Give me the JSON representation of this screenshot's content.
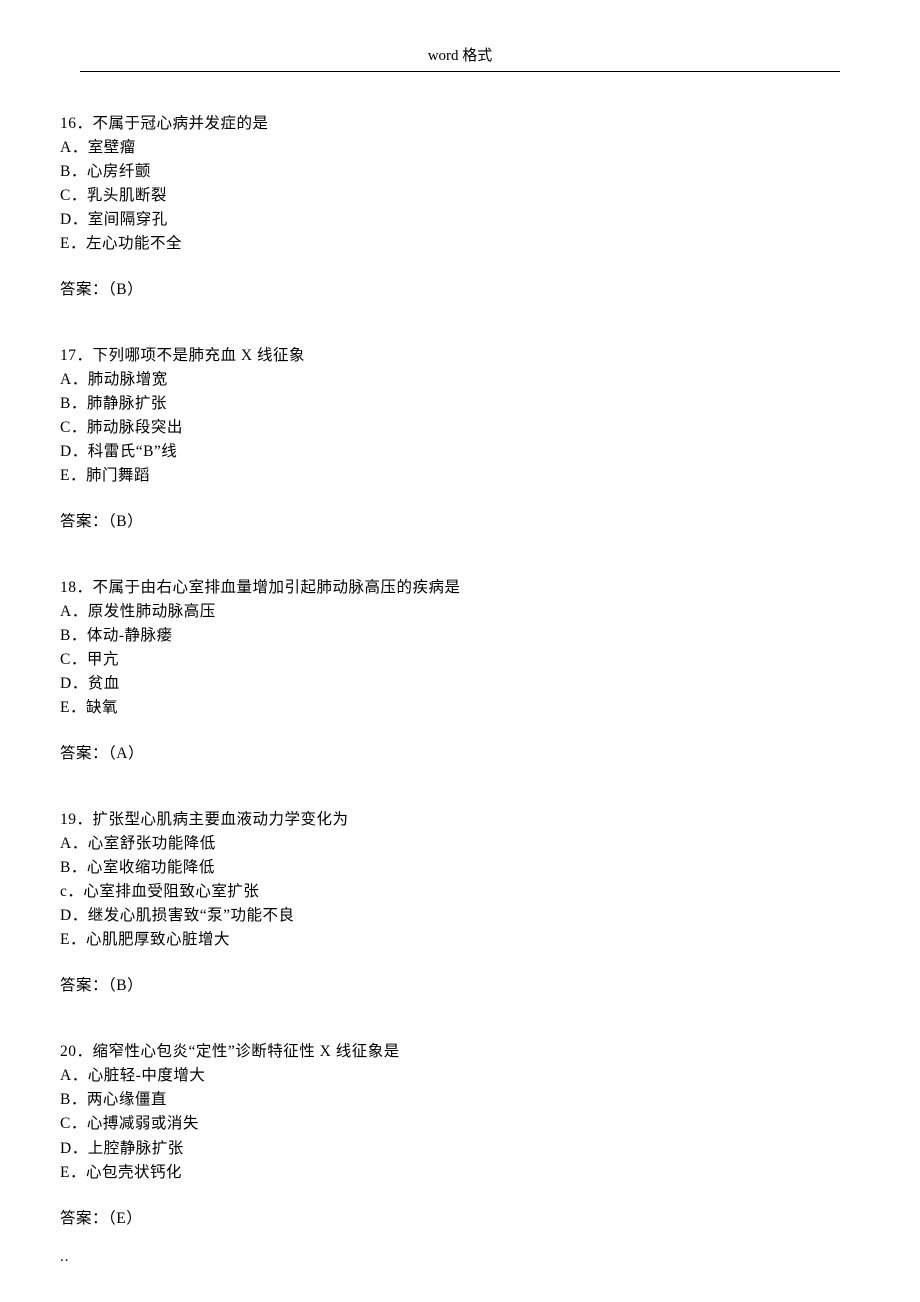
{
  "header": "word 格式",
  "footer": "..",
  "questions": [
    {
      "number": "16．",
      "stem": "不属于冠心病并发症的是",
      "options": [
        "A．室壁瘤",
        "B．心房纤颤",
        "C．乳头肌断裂",
        "D．室间隔穿孔",
        "E．左心功能不全"
      ],
      "answer_label": "答案：（B）"
    },
    {
      "number": "17．",
      "stem": "下列哪项不是肺充血 X 线征象",
      "options": [
        "A．肺动脉增宽",
        "B．肺静脉扩张",
        "C．肺动脉段突出",
        "D．科雷氏“B”线",
        "E．肺门舞蹈"
      ],
      "answer_label": "答案：（B）"
    },
    {
      "number": "18．",
      "stem": "不属于由右心室排血量增加引起肺动脉高压的疾病是",
      "options": [
        "A．原发性肺动脉高压",
        "B．体动-静脉瘘",
        "C．甲亢",
        "D．贫血",
        "E．缺氧"
      ],
      "answer_label": "答案：（A）"
    },
    {
      "number": "19．",
      "stem": "扩张型心肌病主要血液动力学变化为",
      "options": [
        "A．心室舒张功能降低",
        "B．心室收缩功能降低",
        "c．心室排血受阻致心室扩张",
        "D．继发心肌损害致“泵”功能不良",
        "E．心肌肥厚致心脏增大"
      ],
      "answer_label": "答案：（B）"
    },
    {
      "number": "20．",
      "stem": "缩窄性心包炎“定性”诊断特征性 X 线征象是",
      "options": [
        "A．心脏轻-中度增大",
        "B．两心缘僵直",
        "C．心搏减弱或消失",
        "D．上腔静脉扩张",
        "E．心包壳状钙化"
      ],
      "answer_label": "答案：（E）"
    }
  ]
}
